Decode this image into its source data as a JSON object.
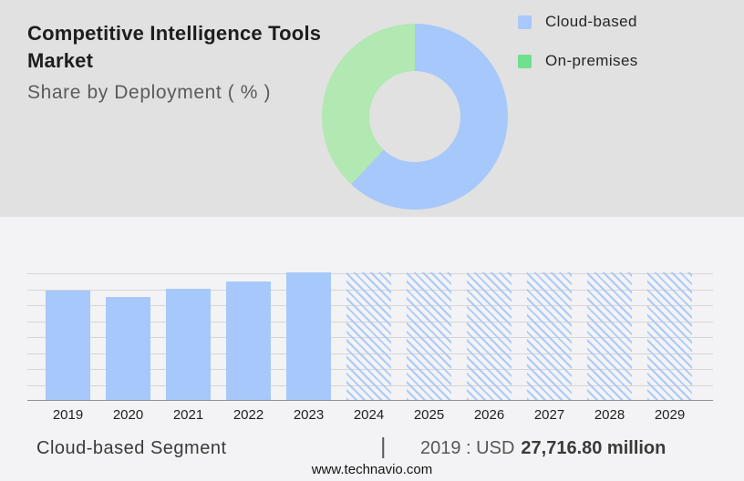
{
  "header": {
    "title": "Competitive Intelligence Tools Market",
    "subtitle": "Share by Deployment ( % )"
  },
  "legend": {
    "items": [
      {
        "label": "Cloud-based",
        "color": "#a9c8fb",
        "swatch": "blue-square"
      },
      {
        "label": "On-premises",
        "color": "#6fe08e",
        "swatch": "green-square"
      }
    ]
  },
  "footer": {
    "segment_label": "Cloud-based Segment",
    "separator": "|",
    "value_prefix": "2019 : USD",
    "value_bold": "27,716.80 million",
    "website": "www.technavio.com"
  },
  "colors": {
    "panel_bg": "#e1e1e1",
    "page_bg": "#f3f3f5",
    "bar_blue": "#a6c8fa",
    "hatch_stripe": "#abcaf8",
    "donut_green": "#b2e8b2",
    "gridline": "#d5d5d7",
    "axis": "#8f8f8f"
  },
  "chart_data": [
    {
      "type": "pie",
      "subtype": "donut",
      "title": "Share by Deployment ( % )",
      "labels": [
        "Cloud-based",
        "On-premises"
      ],
      "values_pct_est": [
        62,
        38
      ],
      "colors": [
        "#a6c8fa",
        "#b2e8b2"
      ],
      "legend_position": "right",
      "note": "no data labels shown in figure; percentages estimated from arc angles"
    },
    {
      "type": "bar",
      "title": "Cloud-based Segment",
      "categories": [
        "2019",
        "2020",
        "2021",
        "2022",
        "2023",
        "2024",
        "2025",
        "2026",
        "2027",
        "2028",
        "2029"
      ],
      "series": [
        {
          "name": "Cloud-based segment size (USD million)",
          "values_est_usd_million": [
            27716.8,
            25800,
            27800,
            29800,
            32000,
            null,
            null,
            null,
            null,
            null,
            null
          ],
          "bar_height_pct_of_plot": [
            86,
            81,
            87,
            93,
            100,
            100,
            100,
            100,
            100,
            100,
            100
          ]
        }
      ],
      "solid_categories": [
        "2019",
        "2020",
        "2021",
        "2022",
        "2023"
      ],
      "hatched_categories": [
        "2024",
        "2025",
        "2026",
        "2027",
        "2028",
        "2029"
      ],
      "annotation": "2019 : USD 27,716.80 million",
      "gridline_count": 9,
      "y_axis_labels": "none",
      "grid": "horizontal"
    }
  ]
}
